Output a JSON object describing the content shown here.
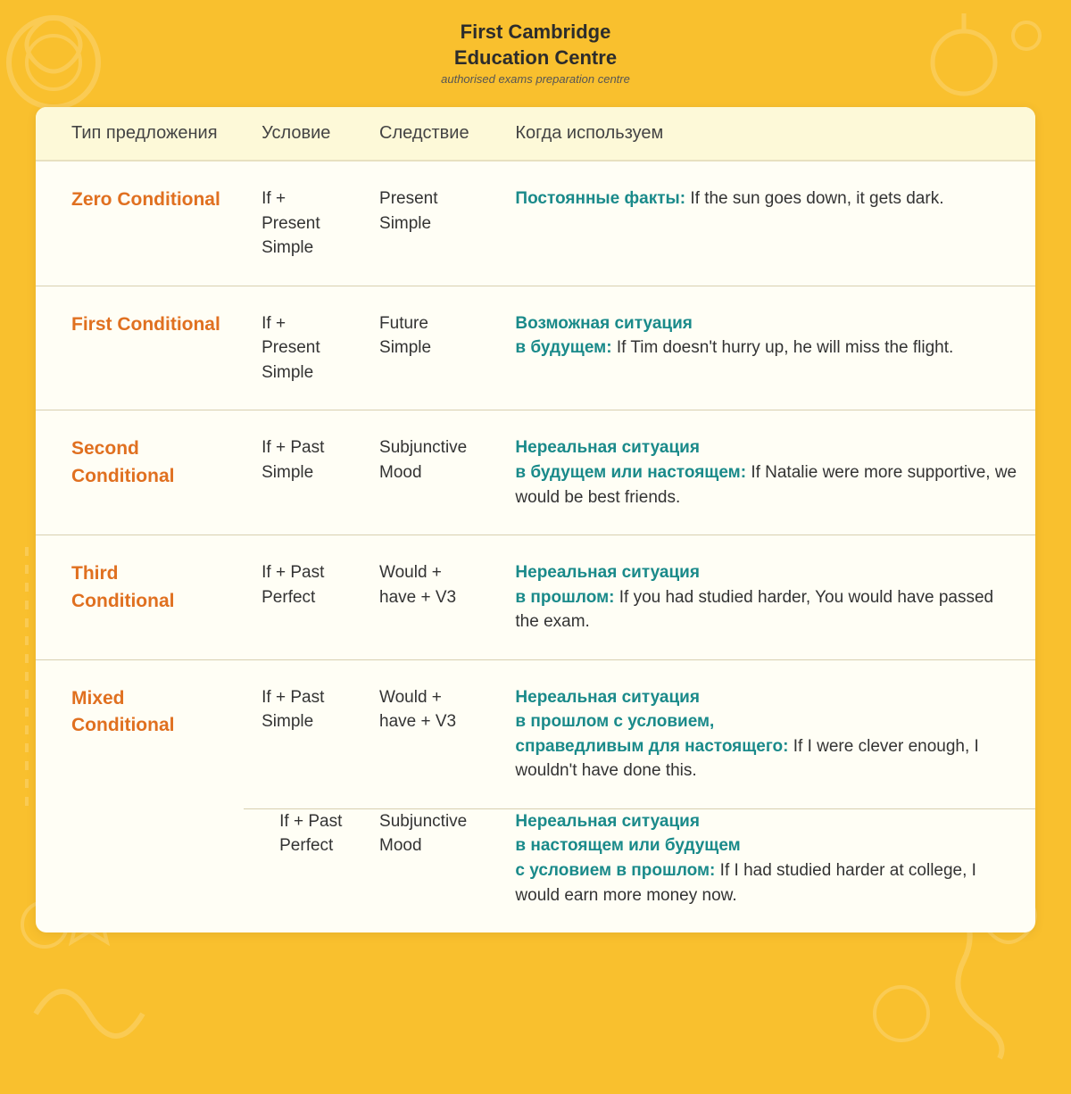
{
  "header": {
    "title_line1": "First Cambridge",
    "title_line2": "Education Centre",
    "subtitle": "authorised exams preparation centre"
  },
  "table": {
    "columns": [
      "Тип предложения",
      "Условие",
      "Следствие",
      "Когда используем"
    ],
    "rows": [
      {
        "name": "Zero Conditional",
        "condition": "If + Present\nSimple",
        "result": "Present\nSimple",
        "usage_bold": "Постоянные факты:",
        "usage_text": " If the sun goes down, it gets dark."
      },
      {
        "name": "First Conditional",
        "condition": "If + Present\nSimple",
        "result": "Future Simple",
        "usage_bold": "Возможная ситуация\nв будущем:",
        "usage_text": " If Tim doesn't hurry up, he will miss the flight."
      },
      {
        "name": "Second Conditional",
        "condition": "If + Past\nSimple",
        "result": "Subjunctive\nMood",
        "usage_bold": "Нереальная ситуация\nв будущем или настоящем:",
        "usage_text": " If Natalie were more supportive, we would be best friends."
      },
      {
        "name": "Third Conditional",
        "condition": "If + Past\nPerfect",
        "result": "Would +\nhave + V3",
        "usage_bold": "Нереальная ситуация\nв прошлом:",
        "usage_text": " If you had studied harder, You would have passed the exam."
      },
      {
        "name": "Mixed Conditional",
        "condition1": "If + Past\nSimple",
        "result1": "Would +\nhave + V3",
        "usage_bold1": "Нереальная ситуация\nв прошлом с условием,\nсправедливым для настоящего:",
        "usage_text1": " If I were clever enough, I wouldn't have done this.",
        "condition2": "If + Past\nPerfect",
        "result2": "Subjunctive\nMood",
        "usage_bold2": "Нереальная ситуация\nв настоящем или будущем\nс условием в прошлом:",
        "usage_text2": " If I had studied harder at college, I would earn more money now."
      }
    ]
  }
}
